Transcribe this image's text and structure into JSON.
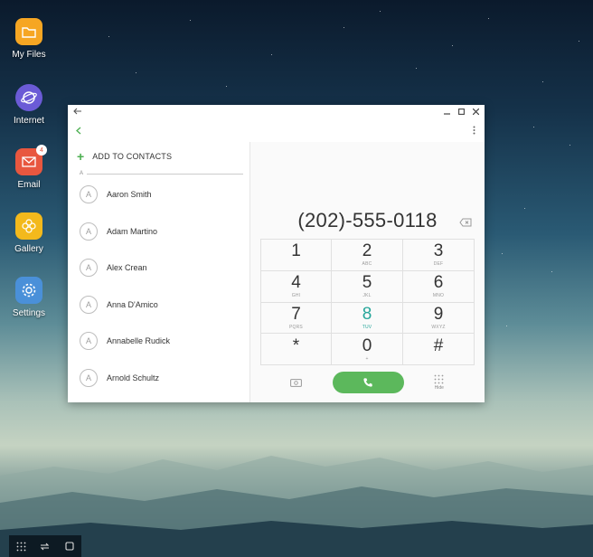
{
  "desktop": {
    "icons": [
      {
        "label": "My Files",
        "icon": "folder-icon",
        "color": "#f6a623"
      },
      {
        "label": "Internet",
        "icon": "globe-icon",
        "color": "#6b5bd6"
      },
      {
        "label": "Email",
        "icon": "envelope-icon",
        "color": "#e8573f",
        "badge": "4"
      },
      {
        "label": "Gallery",
        "icon": "flower-icon",
        "color": "#f3b91c"
      },
      {
        "label": "Settings",
        "icon": "gear-icon",
        "color": "#4a90d9"
      }
    ]
  },
  "window": {
    "contacts": {
      "add_label": "ADD TO CONTACTS",
      "section_letter": "A",
      "items": [
        {
          "initial": "A",
          "name": "Aaron Smith"
        },
        {
          "initial": "A",
          "name": "Adam Martino"
        },
        {
          "initial": "A",
          "name": "Alex Crean"
        },
        {
          "initial": "A",
          "name": "Anna D'Amico"
        },
        {
          "initial": "A",
          "name": "Annabelle Rudick"
        },
        {
          "initial": "A",
          "name": "Arnold Schultz"
        }
      ]
    },
    "dialer": {
      "number": "(202)-555-0118",
      "keys": [
        {
          "digit": "1",
          "letters": ""
        },
        {
          "digit": "2",
          "letters": "ABC"
        },
        {
          "digit": "3",
          "letters": "DEF"
        },
        {
          "digit": "4",
          "letters": "GHI"
        },
        {
          "digit": "5",
          "letters": "JKL"
        },
        {
          "digit": "6",
          "letters": "MNO"
        },
        {
          "digit": "7",
          "letters": "PQRS"
        },
        {
          "digit": "8",
          "letters": "TUV"
        },
        {
          "digit": "9",
          "letters": "WXYZ"
        },
        {
          "digit": "*",
          "letters": ""
        },
        {
          "digit": "0",
          "letters": "+"
        },
        {
          "digit": "#",
          "letters": ""
        }
      ],
      "highlighted_key": "8",
      "hide_label": "Hide",
      "call_color": "#5cb85c",
      "accent_color": "#26a69a"
    }
  }
}
